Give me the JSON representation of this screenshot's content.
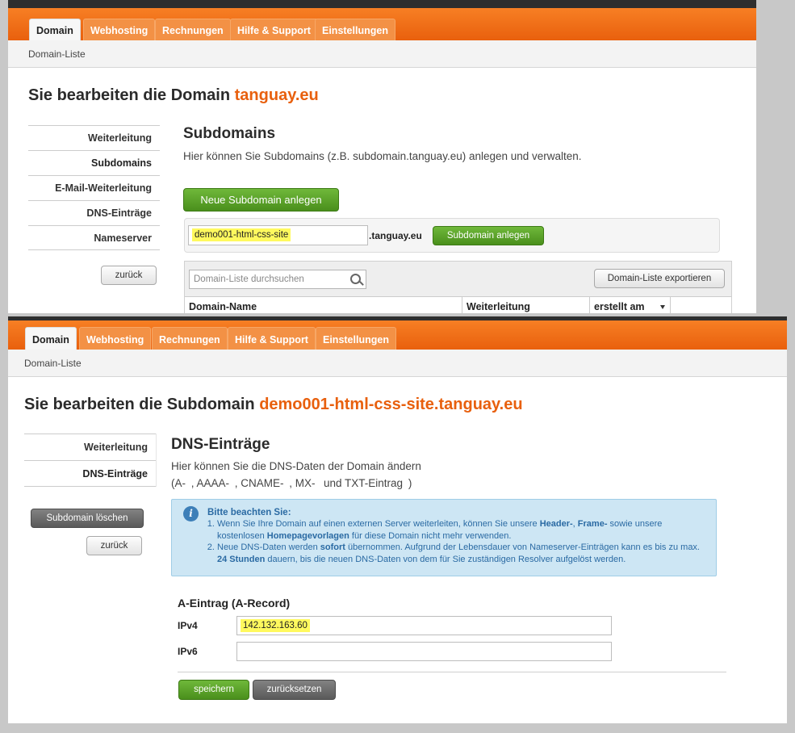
{
  "top": {
    "tabs": [
      "Domain",
      "Webhosting",
      "Rechnungen",
      "Hilfe & Support",
      "Einstellungen"
    ],
    "breadcrumb": "Domain-Liste",
    "title_prefix": "Sie bearbeiten die Domain",
    "title_domain": "tanguay.eu",
    "nav": [
      "Weiterleitung",
      "Subdomains",
      "E-Mail-Weiterleitung",
      "DNS-Einträge",
      "Nameserver"
    ],
    "back": "zurück",
    "section_title": "Subdomains",
    "section_desc": "Hier können Sie Subdomains (z.B. subdomain.tanguay.eu) anlegen und verwalten.",
    "new_button": "Neue Subdomain anlegen",
    "subdomain_value": "demo001-html-css-site",
    "suffix": ".tanguay.eu",
    "create_button": "Subdomain anlegen",
    "search_placeholder": "Domain-Liste durchsuchen",
    "export_button": "Domain-Liste exportieren",
    "columns": [
      "Domain-Name",
      "Weiterleitung",
      "erstellt am"
    ]
  },
  "bottom": {
    "tabs": [
      "Domain",
      "Webhosting",
      "Rechnungen",
      "Hilfe & Support",
      "Einstellungen"
    ],
    "breadcrumb": "Domain-Liste",
    "title_prefix": "Sie bearbeiten die Subdomain",
    "title_domain": "demo001-html-css-site.tanguay.eu",
    "nav": [
      "Weiterleitung",
      "DNS-Einträge"
    ],
    "delete_button": "Subdomain löschen",
    "back": "zurück",
    "section_title": "DNS-Einträge",
    "desc1": "Hier können Sie die DNS-Daten der Domain ändern",
    "desc2": "(A- , AAAA- , CNAME- , MX-  und TXT-Eintrag )",
    "info": {
      "title": "Bitte beachten Sie:",
      "item1_a": "Wenn Sie Ihre Domain auf einen externen Server weiterleiten, können Sie unsere ",
      "item1_b": "Header-",
      "item1_c": ", ",
      "item1_d": "Frame-",
      "item1_e": " sowie unsere kostenlosen ",
      "item1_f": "Homepagevorlagen",
      "item1_g": " für diese Domain nicht mehr verwenden.",
      "item2_a": "Neue DNS-Daten werden ",
      "item2_b": "sofort",
      "item2_c": " übernommen. Aufgrund der Lebensdauer von Nameserver-Einträgen kann es bis zu max. ",
      "item2_d": "24 Stunden",
      "item2_e": " dauern, bis die neuen DNS-Daten von dem für Sie zuständigen Resolver aufgelöst werden."
    },
    "record_title": "A-Eintrag (A-Record)",
    "ipv4_label": "IPv4",
    "ipv4_value": "142.132.163.60",
    "ipv6_label": "IPv6",
    "ipv6_value": "",
    "save_button": "speichern",
    "reset_button": "zurücksetzen"
  }
}
